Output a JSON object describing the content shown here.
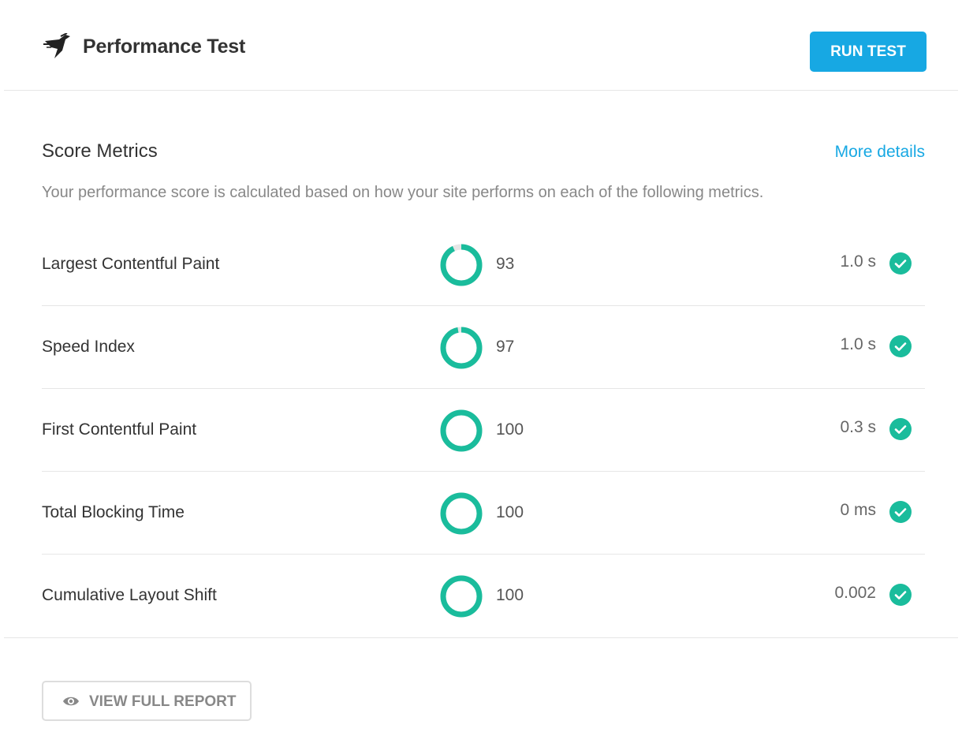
{
  "header": {
    "title": "Performance Test",
    "run_button": "RUN TEST"
  },
  "section": {
    "title": "Score Metrics",
    "more_details": "More details",
    "description": "Your performance score is calculated based on how your site performs on each of the following metrics."
  },
  "metrics": [
    {
      "name": "Largest Contentful Paint",
      "score": 93,
      "value": "1.0 s"
    },
    {
      "name": "Speed Index",
      "score": 97,
      "value": "1.0 s"
    },
    {
      "name": "First Contentful Paint",
      "score": 100,
      "value": "0.3 s"
    },
    {
      "name": "Total Blocking Time",
      "score": 100,
      "value": "0 ms"
    },
    {
      "name": "Cumulative Layout Shift",
      "score": 100,
      "value": "0.002"
    }
  ],
  "footer": {
    "report_button": "VIEW FULL REPORT"
  },
  "colors": {
    "accent": "#17a8e3",
    "good": "#1abc9c",
    "ring_track": "#e6e6e6"
  },
  "icons": {
    "logo": "hummingbird-logo-icon",
    "status": "check-circle-icon",
    "report": "eye-icon"
  }
}
